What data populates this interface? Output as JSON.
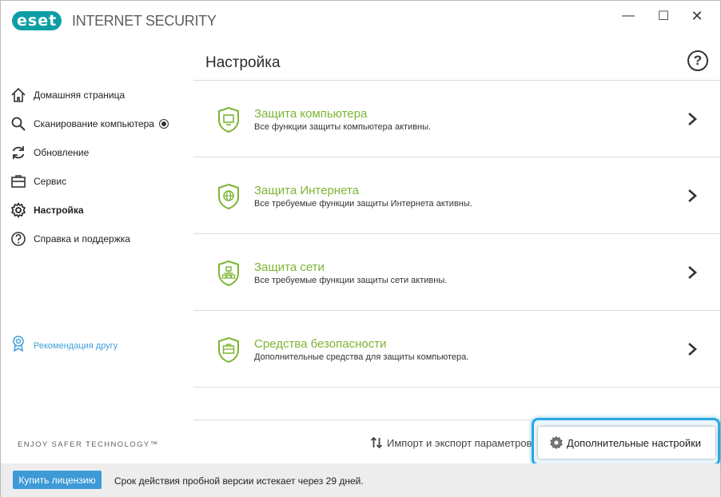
{
  "app": {
    "logo_text": "eset",
    "product_name": "INTERNET SECURITY",
    "brand_color": "#0d9ea5",
    "accent_green": "#7cb534",
    "accent_blue": "#3d9ad6"
  },
  "window_controls": {
    "minimize": "—",
    "maximize": "☐",
    "close": "✕"
  },
  "sidebar": {
    "items": [
      {
        "label": "Домашняя страница",
        "icon": "home-icon"
      },
      {
        "label": "Сканирование компьютера",
        "icon": "search-icon"
      },
      {
        "label": "Обновление",
        "icon": "refresh-icon"
      },
      {
        "label": "Сервис",
        "icon": "toolbox-icon"
      },
      {
        "label": "Настройка",
        "icon": "gear-icon"
      },
      {
        "label": "Справка и поддержка",
        "icon": "help-icon"
      }
    ],
    "refer_friend": "Рекомендация другу",
    "tagline": "ENJOY SAFER TECHNOLOGY™"
  },
  "main": {
    "title": "Настройка",
    "help": "?",
    "sections": [
      {
        "title": "Защита компьютера",
        "desc": "Все функции защиты компьютера активны.",
        "icon": "computer-shield-icon"
      },
      {
        "title": "Защита Интернета",
        "desc": "Все требуемые функции защиты Интернета активны.",
        "icon": "globe-shield-icon"
      },
      {
        "title": "Защита сети",
        "desc": "Все требуемые функции защиты сети активны.",
        "icon": "network-shield-icon"
      },
      {
        "title": "Средства безопасности",
        "desc": "Дополнительные средства для защиты компьютера.",
        "icon": "toolkit-shield-icon"
      }
    ],
    "import_export": "Импорт и экспорт параметров",
    "advanced_settings": "Дополнительные настройки"
  },
  "footer": {
    "buy_button": "Купить лицензию",
    "trial_text": "Срок действия пробной версии истекает через 29 дней."
  }
}
